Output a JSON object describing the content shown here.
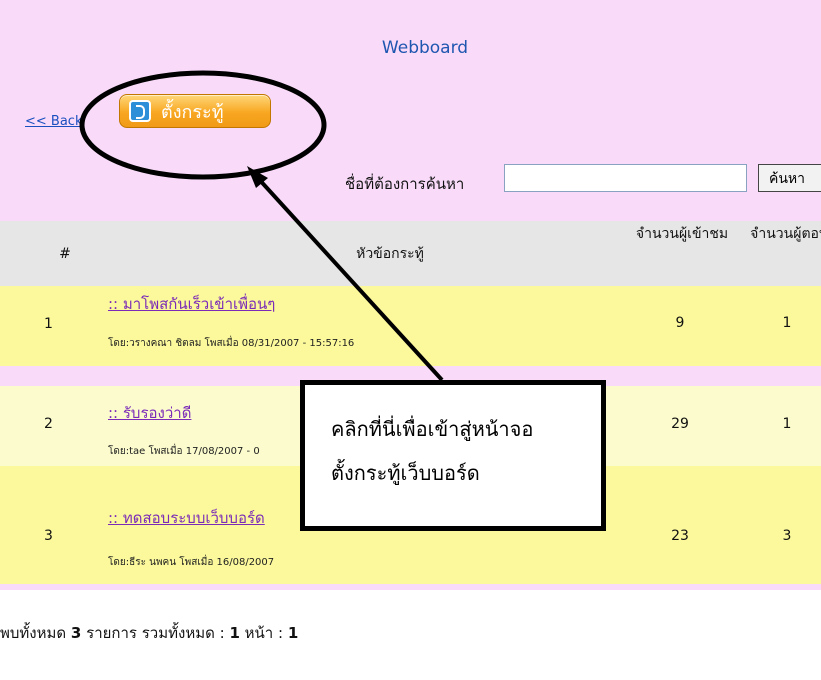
{
  "header": {
    "title": "Webboard"
  },
  "nav": {
    "back_label": "<< Back",
    "post_button_label": "ตั้งกระทู้"
  },
  "search": {
    "label": "ชื่อที่ต้องการค้นหา",
    "value": "",
    "button_label": "ค้นหา"
  },
  "table": {
    "columns": [
      "#",
      "หัวข้อกระทู้",
      "จำนวนผู้เข้าชม",
      "จำนวนผู้ตอบ"
    ],
    "rows": [
      {
        "num": "1",
        "topic": ":: มาโพสกันเร็วเข้าเพื่อนๆ",
        "meta": "โดย:วรางคณา ชิตลม โพสเมื่อ 08/31/2007 - 15:57:16",
        "views": "9",
        "replies": "1"
      },
      {
        "num": "2",
        "topic": ":: รับรองว่าดี",
        "meta": "โดย:tae โพสเมื่อ 17/08/2007 - 0",
        "views": "29",
        "replies": "1"
      },
      {
        "num": "3",
        "topic": ":: ทดสอบระบบเว็บบอร์ด",
        "meta": "โดย:ธีระ นพคน โพสเมื่อ 16/08/2007",
        "views": "23",
        "replies": "3"
      }
    ]
  },
  "summary": {
    "prefix": "พบทั้งหมด",
    "count": "3",
    "middle": "รายการ รวมทั้งหมด :",
    "pages": "1",
    "suffix": "หน้า :",
    "current_page": "1"
  },
  "annotation": {
    "line1": "คลิกที่นี่เพื่อเข้าสู่หน้าจอ",
    "line2": "ตั้งกระทู้เว็บบอร์ด"
  }
}
